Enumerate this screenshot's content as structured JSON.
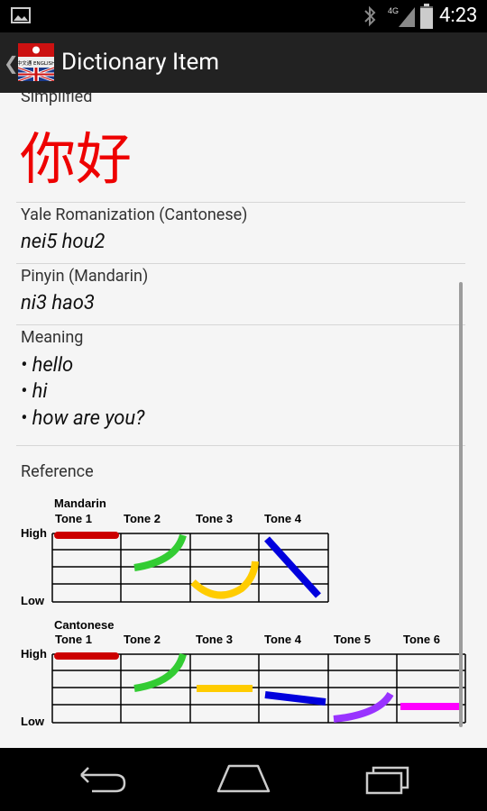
{
  "status_bar": {
    "time": "4:23",
    "network": "4G",
    "icons": [
      "gallery-icon",
      "bluetooth-icon",
      "signal-icon",
      "battery-icon"
    ]
  },
  "action_bar": {
    "title": "Dictionary Item",
    "app_icon_text": "中文通 ENGLISH"
  },
  "item": {
    "simplified_label": "Simplified",
    "characters": "你好",
    "yale_label": "Yale Romanization (Cantonese)",
    "yale_value": "nei5 hou2",
    "pinyin_label": "Pinyin (Mandarin)",
    "pinyin_value": "ni3 hao3",
    "meaning_label": "Meaning",
    "meanings": [
      "• hello",
      "• hi",
      "• how are you?"
    ]
  },
  "reference": {
    "label": "Reference",
    "high_label": "High",
    "low_label": "Low",
    "mandarin": {
      "name": "Mandarin",
      "tones": [
        "Tone 1",
        "Tone 2",
        "Tone 3",
        "Tone 4"
      ],
      "colors": [
        "#cc0000",
        "#33cc33",
        "#ffcc00",
        "#0000dd"
      ]
    },
    "cantonese": {
      "name": "Cantonese",
      "tones": [
        "Tone 1",
        "Tone 2",
        "Tone 3",
        "Tone 4",
        "Tone 5",
        "Tone 6"
      ],
      "colors": [
        "#cc0000",
        "#33cc33",
        "#ffcc00",
        "#0000dd",
        "#9933ff",
        "#ff00ff"
      ]
    }
  },
  "nav_bar": {
    "buttons": [
      "back-icon",
      "home-icon",
      "recent-apps-icon"
    ]
  }
}
